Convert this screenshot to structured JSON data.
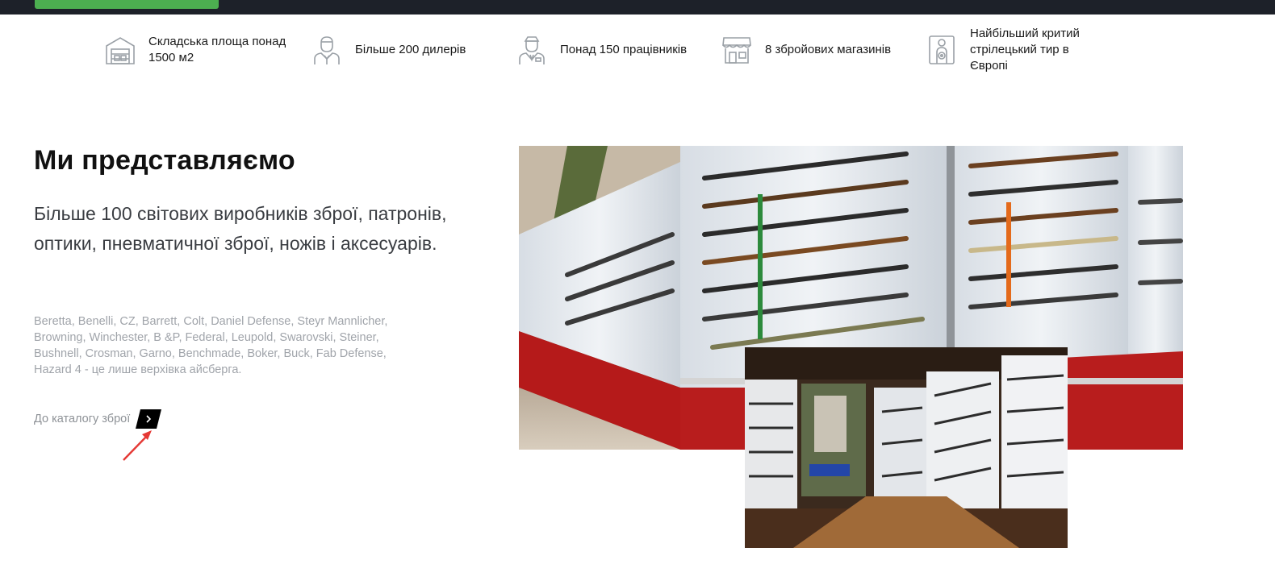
{
  "features": [
    {
      "icon": "warehouse-icon",
      "text": "Складська площа понад 1500 м2"
    },
    {
      "icon": "dealer-icon",
      "text": "Більше 200 дилерів"
    },
    {
      "icon": "employee-icon",
      "text": "Понад 150 працівників"
    },
    {
      "icon": "store-icon",
      "text": "8 збройових магазинів"
    },
    {
      "icon": "target-icon",
      "text": "Найбільший критий стрілецький тир в Європі"
    }
  ],
  "about": {
    "title": "Ми представляємо",
    "lead": "Більше 100 світових виробників зброї, патронів, оптики, пневматичної зброї, ножів і аксесуарів.",
    "brands": "Beretta, Benelli, CZ, Barrett, Colt, Daniel Defense, Steyr Mannlicher, Browning, Winchester, B &P, Federal, Leupold, Swarovski, Steiner, Bushnell, Crosman, Garno, Benchmade, Boker, Buck, Fab Defense, Hazard 4 - це лише верхівка айсберга.",
    "catalog_link": "До каталогу зброї"
  },
  "colors": {
    "topbar": "#1d2129",
    "accent_green": "#4caf50",
    "annotation_red": "#e53935"
  }
}
